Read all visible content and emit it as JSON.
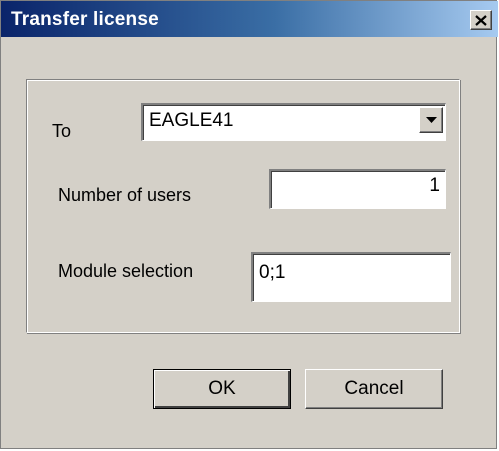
{
  "window": {
    "title": "Transfer license"
  },
  "form": {
    "to_label": "To",
    "to_value": "EAGLE41",
    "users_label": "Number of users",
    "users_value": "1",
    "modules_label": "Module selection",
    "modules_value": "0;1"
  },
  "buttons": {
    "ok_label": "OK",
    "cancel_label": "Cancel"
  },
  "icons": {
    "close": "close-icon",
    "dropdown": "chevron-down-icon"
  }
}
